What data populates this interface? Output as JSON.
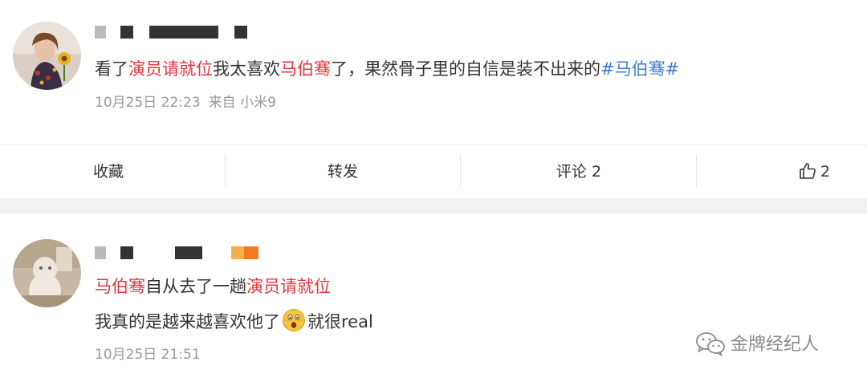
{
  "post": {
    "author_name": "",
    "text_segments": [
      {
        "text": "看了",
        "style": "normal"
      },
      {
        "text": "演员请就位",
        "style": "mention"
      },
      {
        "text": "我太喜欢",
        "style": "normal"
      },
      {
        "text": "马伯骞",
        "style": "mention"
      },
      {
        "text": "了，果然骨子里的自信是装不出来的",
        "style": "normal"
      },
      {
        "text": "#马伯骞#",
        "style": "hashtag"
      }
    ],
    "date": "10月25日 22:23",
    "source": "来自 小米9"
  },
  "actions": {
    "favorite": "收藏",
    "repost": "转发",
    "comment": "评论 2",
    "like_count": "2"
  },
  "comment": {
    "author_name": "",
    "line1_segments": [
      {
        "text": "马伯骞",
        "style": "mention"
      },
      {
        "text": "自从去了一趟",
        "style": "normal"
      },
      {
        "text": "演员请就位",
        "style": "mention"
      }
    ],
    "line2_before_emoji": "我真的是越来越喜欢他了",
    "emoji_name": "shocked-face-emoji",
    "line2_after_emoji": "就很real",
    "date": "10月25日 21:51"
  },
  "watermark": {
    "text": "金牌经纪人",
    "icon": "wechat-icon"
  },
  "colors": {
    "mention": "#e0363c",
    "hashtag": "#3d7cc9",
    "meta": "#999999",
    "text": "#333333",
    "separator_band": "#f2f2f2"
  }
}
